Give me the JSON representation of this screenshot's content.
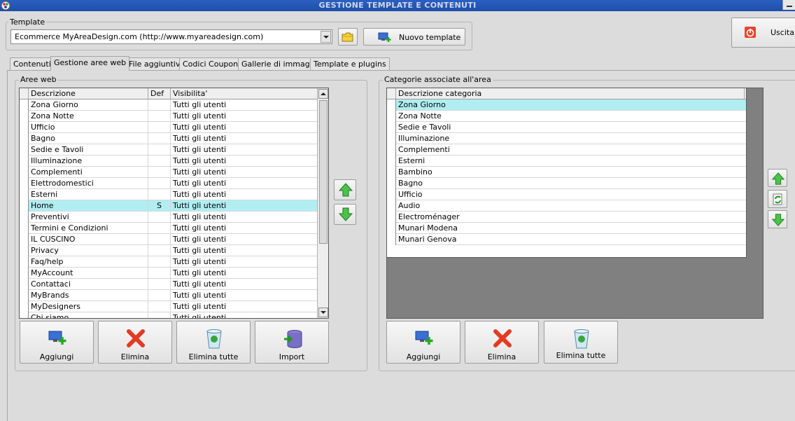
{
  "window": {
    "title": "GESTIONE TEMPLATE E CONTENUTI"
  },
  "template": {
    "label": "Template",
    "selected": "Ecommerce MyAreaDesign.com (http://www.myareadesign.com)",
    "new_button": "Nuovo template"
  },
  "exit_button": "Uscita (",
  "tabs": [
    {
      "label": "Contenuti"
    },
    {
      "label": "Gestione aree web"
    },
    {
      "label": "File aggiuntivi"
    },
    {
      "label": "Codici Coupon"
    },
    {
      "label": "Gallerie di immagini"
    },
    {
      "label": "Template e plugins"
    }
  ],
  "aree_web": {
    "title": "Aree web",
    "columns": {
      "descrizione": "Descrizione",
      "def": "Def",
      "visibilita": "Visibilita'"
    },
    "rows": [
      {
        "descrizione": "Zona Giorno",
        "def": "",
        "visibilita": "Tutti gli utenti"
      },
      {
        "descrizione": "Zona Notte",
        "def": "",
        "visibilita": "Tutti gli utenti"
      },
      {
        "descrizione": "Ufficio",
        "def": "",
        "visibilita": "Tutti gli utenti"
      },
      {
        "descrizione": "Bagno",
        "def": "",
        "visibilita": "Tutti gli utenti"
      },
      {
        "descrizione": "Sedie e Tavoli",
        "def": "",
        "visibilita": "Tutti gli utenti"
      },
      {
        "descrizione": "Illuminazione",
        "def": "",
        "visibilita": "Tutti gli utenti"
      },
      {
        "descrizione": "Complementi",
        "def": "",
        "visibilita": "Tutti gli utenti"
      },
      {
        "descrizione": "Elettrodomestici",
        "def": "",
        "visibilita": "Tutti gli utenti"
      },
      {
        "descrizione": "Esterni",
        "def": "",
        "visibilita": "Tutti gli utenti"
      },
      {
        "descrizione": "Home",
        "def": "S",
        "visibilita": "Tutti gli utenti",
        "selected": true
      },
      {
        "descrizione": "Preventivi",
        "def": "",
        "visibilita": "Tutti gli utenti"
      },
      {
        "descrizione": "Termini e Condizioni",
        "def": "",
        "visibilita": "Tutti gli utenti"
      },
      {
        "descrizione": "IL CUSCINO",
        "def": "",
        "visibilita": "Tutti gli utenti"
      },
      {
        "descrizione": "Privacy",
        "def": "",
        "visibilita": "Tutti gli utenti"
      },
      {
        "descrizione": "Faq/help",
        "def": "",
        "visibilita": "Tutti gli utenti"
      },
      {
        "descrizione": "MyAccount",
        "def": "",
        "visibilita": "Tutti gli utenti"
      },
      {
        "descrizione": "Contattaci",
        "def": "",
        "visibilita": "Tutti gli utenti"
      },
      {
        "descrizione": "MyBrands",
        "def": "",
        "visibilita": "Tutti gli utenti"
      },
      {
        "descrizione": "MyDesigners",
        "def": "",
        "visibilita": "Tutti gli utenti"
      },
      {
        "descrizione": "Chi siamo",
        "def": "",
        "visibilita": "Tutti gli utenti"
      }
    ],
    "buttons": {
      "aggiungi": "Aggiungi",
      "elimina": "Elimina",
      "elimina_tutte": "Elimina tutte",
      "import": "Import"
    }
  },
  "categorie": {
    "title": "Categorie associate all'area",
    "column": "Descrizione categoria",
    "rows": [
      {
        "descrizione": "Zona Giorno",
        "selected": true
      },
      {
        "descrizione": "Zona Notte"
      },
      {
        "descrizione": "Sedie e Tavoli"
      },
      {
        "descrizione": "Illuminazione"
      },
      {
        "descrizione": "Complementi"
      },
      {
        "descrizione": "Esterni"
      },
      {
        "descrizione": "Bambino"
      },
      {
        "descrizione": "Bagno"
      },
      {
        "descrizione": "Ufficio"
      },
      {
        "descrizione": "Audio"
      },
      {
        "descrizione": "Electroménager"
      },
      {
        "descrizione": "Munari Modena"
      },
      {
        "descrizione": "Munari Genova"
      }
    ],
    "buttons": {
      "aggiungi": "Aggiungi",
      "elimina": "Elimina",
      "elimina_tutte": "Elimina tutte"
    }
  },
  "colors": {
    "selection": "#b0eef2",
    "title_bar": "#2a5fc1",
    "grid_background_dark": "#808080"
  }
}
